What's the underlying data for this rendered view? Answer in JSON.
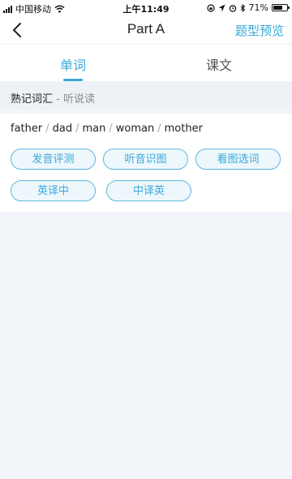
{
  "status_bar": {
    "carrier": "中国移动",
    "time": "上午11:49",
    "battery_text": "71%",
    "battery_level": 0.71
  },
  "nav": {
    "title": "Part A",
    "right_action": "题型预览"
  },
  "tabs": [
    {
      "label": "单词",
      "active": true
    },
    {
      "label": "课文",
      "active": false
    }
  ],
  "section": {
    "title": "熟记词汇",
    "subtitle": "- 听说读"
  },
  "words": [
    "father",
    "dad",
    "man",
    "woman",
    "mother"
  ],
  "word_separator": "/",
  "buttons": [
    {
      "label": "发音评测"
    },
    {
      "label": "听音识图"
    },
    {
      "label": "看图选词"
    },
    {
      "label": "英译中"
    },
    {
      "label": "中译英"
    }
  ],
  "colors": {
    "accent": "#3ba8d9",
    "background": "#f2f5f9",
    "button_fill": "#edf7fc"
  }
}
